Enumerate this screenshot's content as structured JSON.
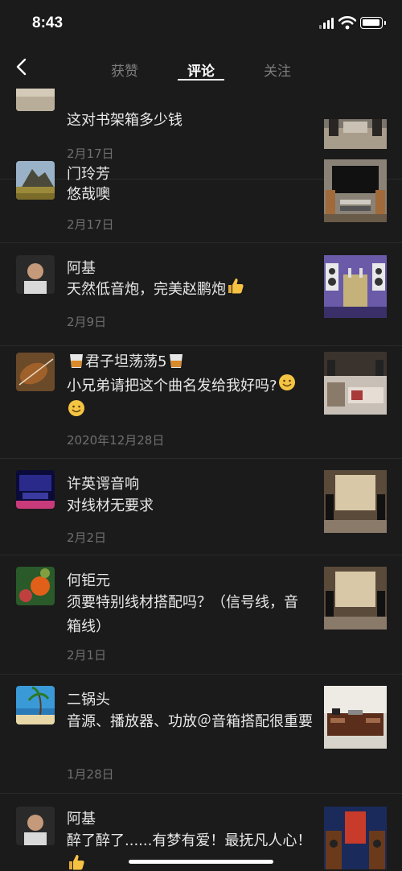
{
  "status_bar": {
    "time": "8:43"
  },
  "header": {
    "tabs": [
      {
        "label": "获赞",
        "active": false
      },
      {
        "label": "评论",
        "active": true
      },
      {
        "label": "关注",
        "active": false
      }
    ]
  },
  "comments": [
    {
      "name": "",
      "text": "这对书架箱多少钱",
      "date": "2月17日",
      "avatar": "partial-avatar",
      "thumb": "living-room-speakers"
    },
    {
      "name": "门玲芳",
      "text": "悠哉噢",
      "date": "2月17日",
      "avatar": "mountain-landscape",
      "thumb": "tv-audio-setup"
    },
    {
      "name": "阿基",
      "text": "天然低音炮，完美赵鹏炮",
      "date": "2月9日",
      "avatar": "man-portrait",
      "thumb": "purple-tube-amp"
    },
    {
      "name": "君子坦荡荡5",
      "text": "小兄弟请把这个曲名发给我好吗?",
      "date": "2020年12月28日",
      "avatar": "violin",
      "thumb": "record-collection-room"
    },
    {
      "name": "许英谔音响",
      "text": "对线材无要求",
      "date": "2月2日",
      "avatar": "concert-stage",
      "thumb": "listening-room-panel"
    },
    {
      "name": "何钜元",
      "text": "须要特别线材搭配吗？（信号线，音箱线）",
      "date": "2月1日",
      "avatar": "butterfly-flowers",
      "thumb": "listening-room-panel"
    },
    {
      "name": "二锅头",
      "text": "音源、播放器、功放＠音箱搭配很重要",
      "date": "1月28日",
      "avatar": "beach-palm",
      "thumb": "white-room-cabinet"
    },
    {
      "name": "阿基",
      "text": "醉了醉了......有梦有爱！最抚凡人心！",
      "date": "",
      "avatar": "man-portrait",
      "thumb": "red-speaker-wall"
    }
  ],
  "icons": {
    "back": "chevron-left-icon",
    "thumbs_up": "thumbs-up-emoji",
    "smile": "smiling-face-emoji",
    "whiskey": "tumbler-glass-emoji"
  },
  "colors": {
    "background": "#1b1b1b",
    "text_primary": "#e8e8e8",
    "text_secondary": "#6f6f6f",
    "tab_inactive": "#7d7d7d",
    "divider": "#2a2a2a"
  }
}
